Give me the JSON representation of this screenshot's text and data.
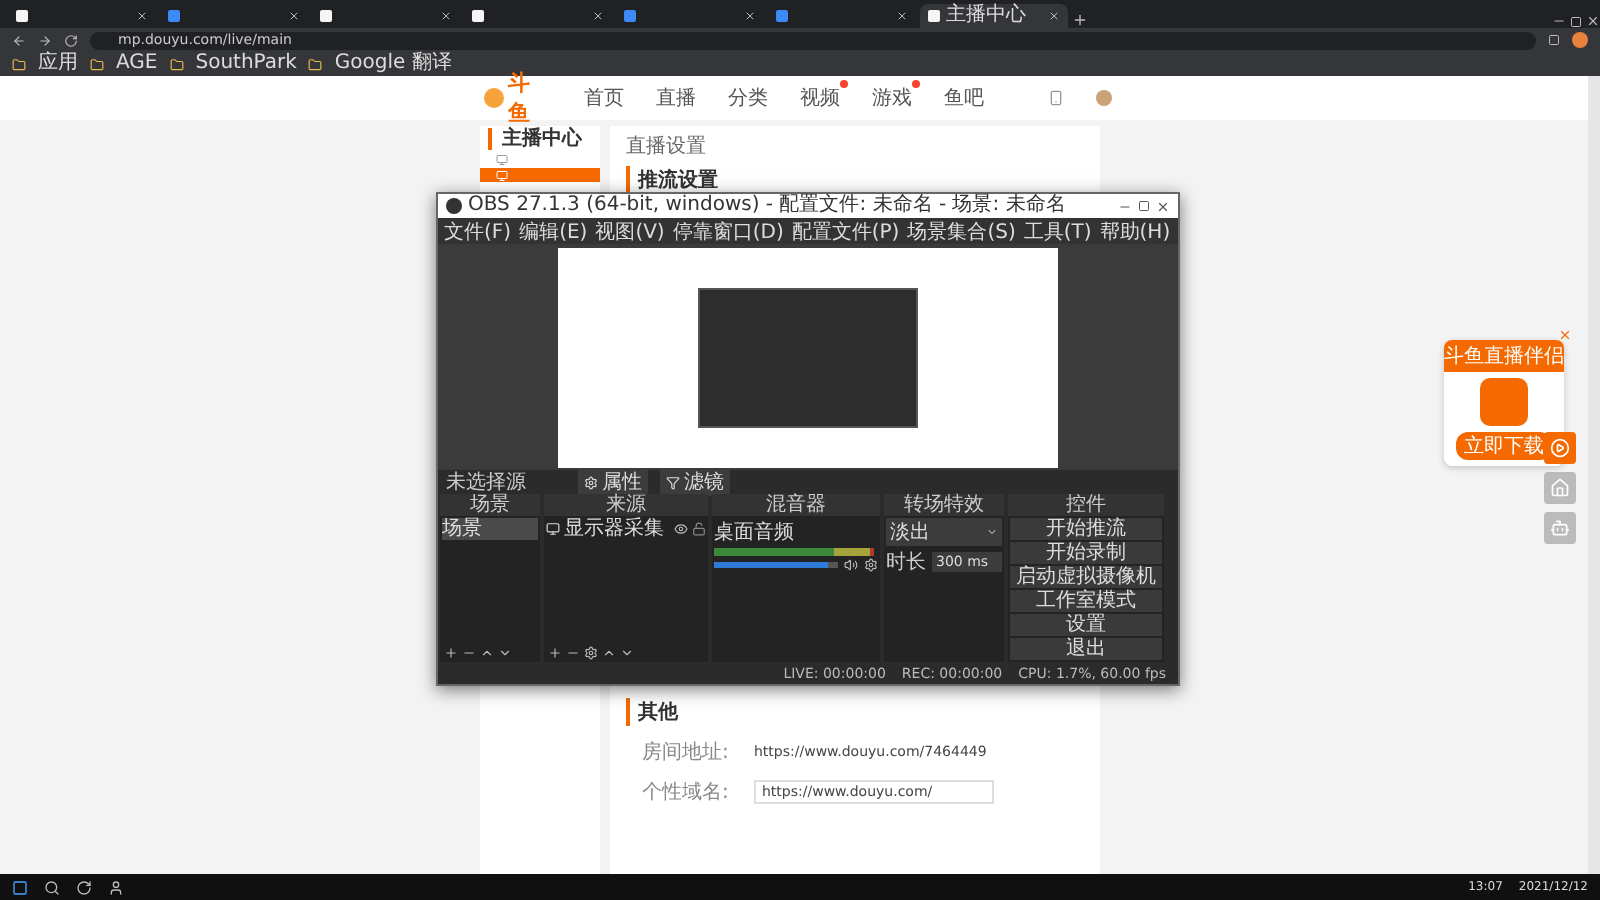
{
  "browser": {
    "tabs": [
      {
        "kind": "douyu",
        "selected": false
      },
      {
        "kind": "video",
        "selected": false
      },
      {
        "kind": "douyu",
        "selected": false
      },
      {
        "kind": "douyu",
        "selected": false
      },
      {
        "kind": "video",
        "selected": false
      },
      {
        "kind": "video",
        "selected": false
      },
      {
        "kind": "douyu",
        "title": "主播中心",
        "selected": true
      }
    ],
    "url": "mp.douyu.com/live/main",
    "bookmarks": [
      {
        "label": "应用"
      },
      {
        "label": "AGE"
      },
      {
        "label": "SouthPark"
      },
      {
        "label": "Google 翻译"
      }
    ]
  },
  "site": {
    "logo": "斗鱼",
    "nav": [
      {
        "label": "首页",
        "dot": false
      },
      {
        "label": "直播",
        "dot": false
      },
      {
        "label": "分类",
        "dot": false
      },
      {
        "label": "视频",
        "dot": true
      },
      {
        "label": "游戏",
        "dot": true
      },
      {
        "label": "鱼吧",
        "dot": false
      }
    ]
  },
  "sidebar": {
    "title": "主播中心",
    "items": [
      {
        "selected": false
      },
      {
        "selected": true
      }
    ]
  },
  "main": {
    "title": "直播设置",
    "section": "推流设置",
    "other": {
      "title": "其他",
      "rows": [
        {
          "kind": "text",
          "label": "房间地址:",
          "value": "https://www.douyu.com/7464449"
        },
        {
          "kind": "input",
          "label": "个性域名:",
          "value": "https://www.douyu.com/"
        }
      ]
    }
  },
  "obs": {
    "title": "OBS 27.1.3 (64-bit, windows) - 配置文件: 未命名 - 场景: 未命名",
    "menu": [
      "文件(F)",
      "编辑(E)",
      "视图(V)",
      "停靠窗口(D)",
      "配置文件(P)",
      "场景集合(S)",
      "工具(T)",
      "帮助(H)"
    ],
    "source_bar": {
      "label": "未选择源",
      "buttons": [
        "属性",
        "滤镜"
      ]
    },
    "docks": {
      "scenes": {
        "title": "场景",
        "items": [
          {
            "label": "场景",
            "selected": true
          }
        ]
      },
      "sources": {
        "title": "来源",
        "items": [
          {
            "label": "显示器采集",
            "visible": true,
            "locked": false
          }
        ]
      },
      "mixer": {
        "title": "混音器",
        "channels": [
          {
            "name": "桌面音频",
            "level": 0.92,
            "muted": false
          }
        ]
      },
      "transitions": {
        "title": "转场特效",
        "value": "淡出",
        "duration_label": "时长",
        "duration": "300 ms"
      },
      "controls": {
        "title": "控件",
        "buttons": [
          "开始推流",
          "开始录制",
          "启动虚拟摄像机",
          "工作室模式",
          "设置",
          "退出"
        ]
      }
    },
    "status": [
      "LIVE: 00:00:00",
      "REC: 00:00:00",
      "CPU: 1.7%, 60.00 fps"
    ]
  },
  "promo": {
    "title": "斗鱼直播伴侣",
    "button": "立即下载"
  },
  "taskbar": {
    "time": "13:07",
    "date": "2021/12/12"
  }
}
